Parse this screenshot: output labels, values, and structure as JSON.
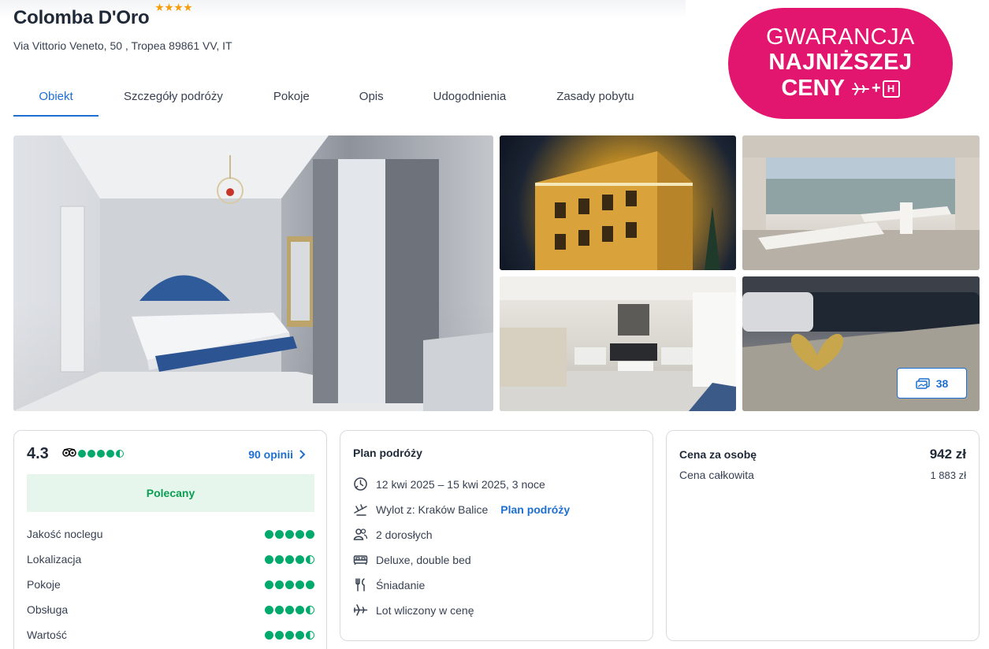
{
  "hotel": {
    "name": "Colomba D'Oro",
    "stars": 4,
    "address": "Via Vittorio Veneto, 50 , Tropea 89861 VV, IT"
  },
  "tabs": [
    {
      "label": "Obiekt",
      "active": true
    },
    {
      "label": "Szczegóły podróży"
    },
    {
      "label": "Pokoje"
    },
    {
      "label": "Opis"
    },
    {
      "label": "Udogodnienia"
    },
    {
      "label": "Zasady pobytu"
    }
  ],
  "badge": {
    "line1": "GWARANCJA",
    "line2": "NAJNIŻSZEJ",
    "line3": "CENY",
    "plus": "+",
    "h_letter": "H",
    "color": "#e2156f"
  },
  "gallery": {
    "photos": [
      {
        "name": "bedroom"
      },
      {
        "name": "exterior-night"
      },
      {
        "name": "terrace"
      },
      {
        "name": "lobby"
      },
      {
        "name": "heart-decor"
      }
    ],
    "count": "38"
  },
  "rating": {
    "score": "4.3",
    "reviews_link": "90 opinii",
    "recommend_label": "Polecany",
    "overall_bubbles": 4.5,
    "categories": [
      {
        "label": "Jakość noclegu",
        "bubbles": 5
      },
      {
        "label": "Lokalizacja",
        "bubbles": 4.5
      },
      {
        "label": "Pokoje",
        "bubbles": 5
      },
      {
        "label": "Obsługa",
        "bubbles": 4.5
      },
      {
        "label": "Wartość",
        "bubbles": 4.5
      }
    ],
    "accent": "#00aa6c"
  },
  "plan": {
    "title": "Plan podróży",
    "items": [
      {
        "icon": "calendar-clock-icon",
        "text": "12 kwi 2025 – 15 kwi 2025, 3 noce"
      },
      {
        "icon": "plane-departure-icon",
        "text": "Wylot z: Kraków Balice",
        "link": "Plan podróży"
      },
      {
        "icon": "people-icon",
        "text": "2 dorosłych"
      },
      {
        "icon": "bed-icon",
        "text": "Deluxe, double bed"
      },
      {
        "icon": "cutlery-icon",
        "text": "Śniadanie"
      },
      {
        "icon": "plane-icon",
        "text": "Lot wliczony w cenę"
      }
    ]
  },
  "price": {
    "per_person_label": "Cena za osobę",
    "per_person_value": "942 zł",
    "total_label": "Cena całkowita",
    "total_value": "1 883 zł"
  },
  "colors": {
    "link": "#1d6fd1",
    "text": "#1f2937"
  }
}
